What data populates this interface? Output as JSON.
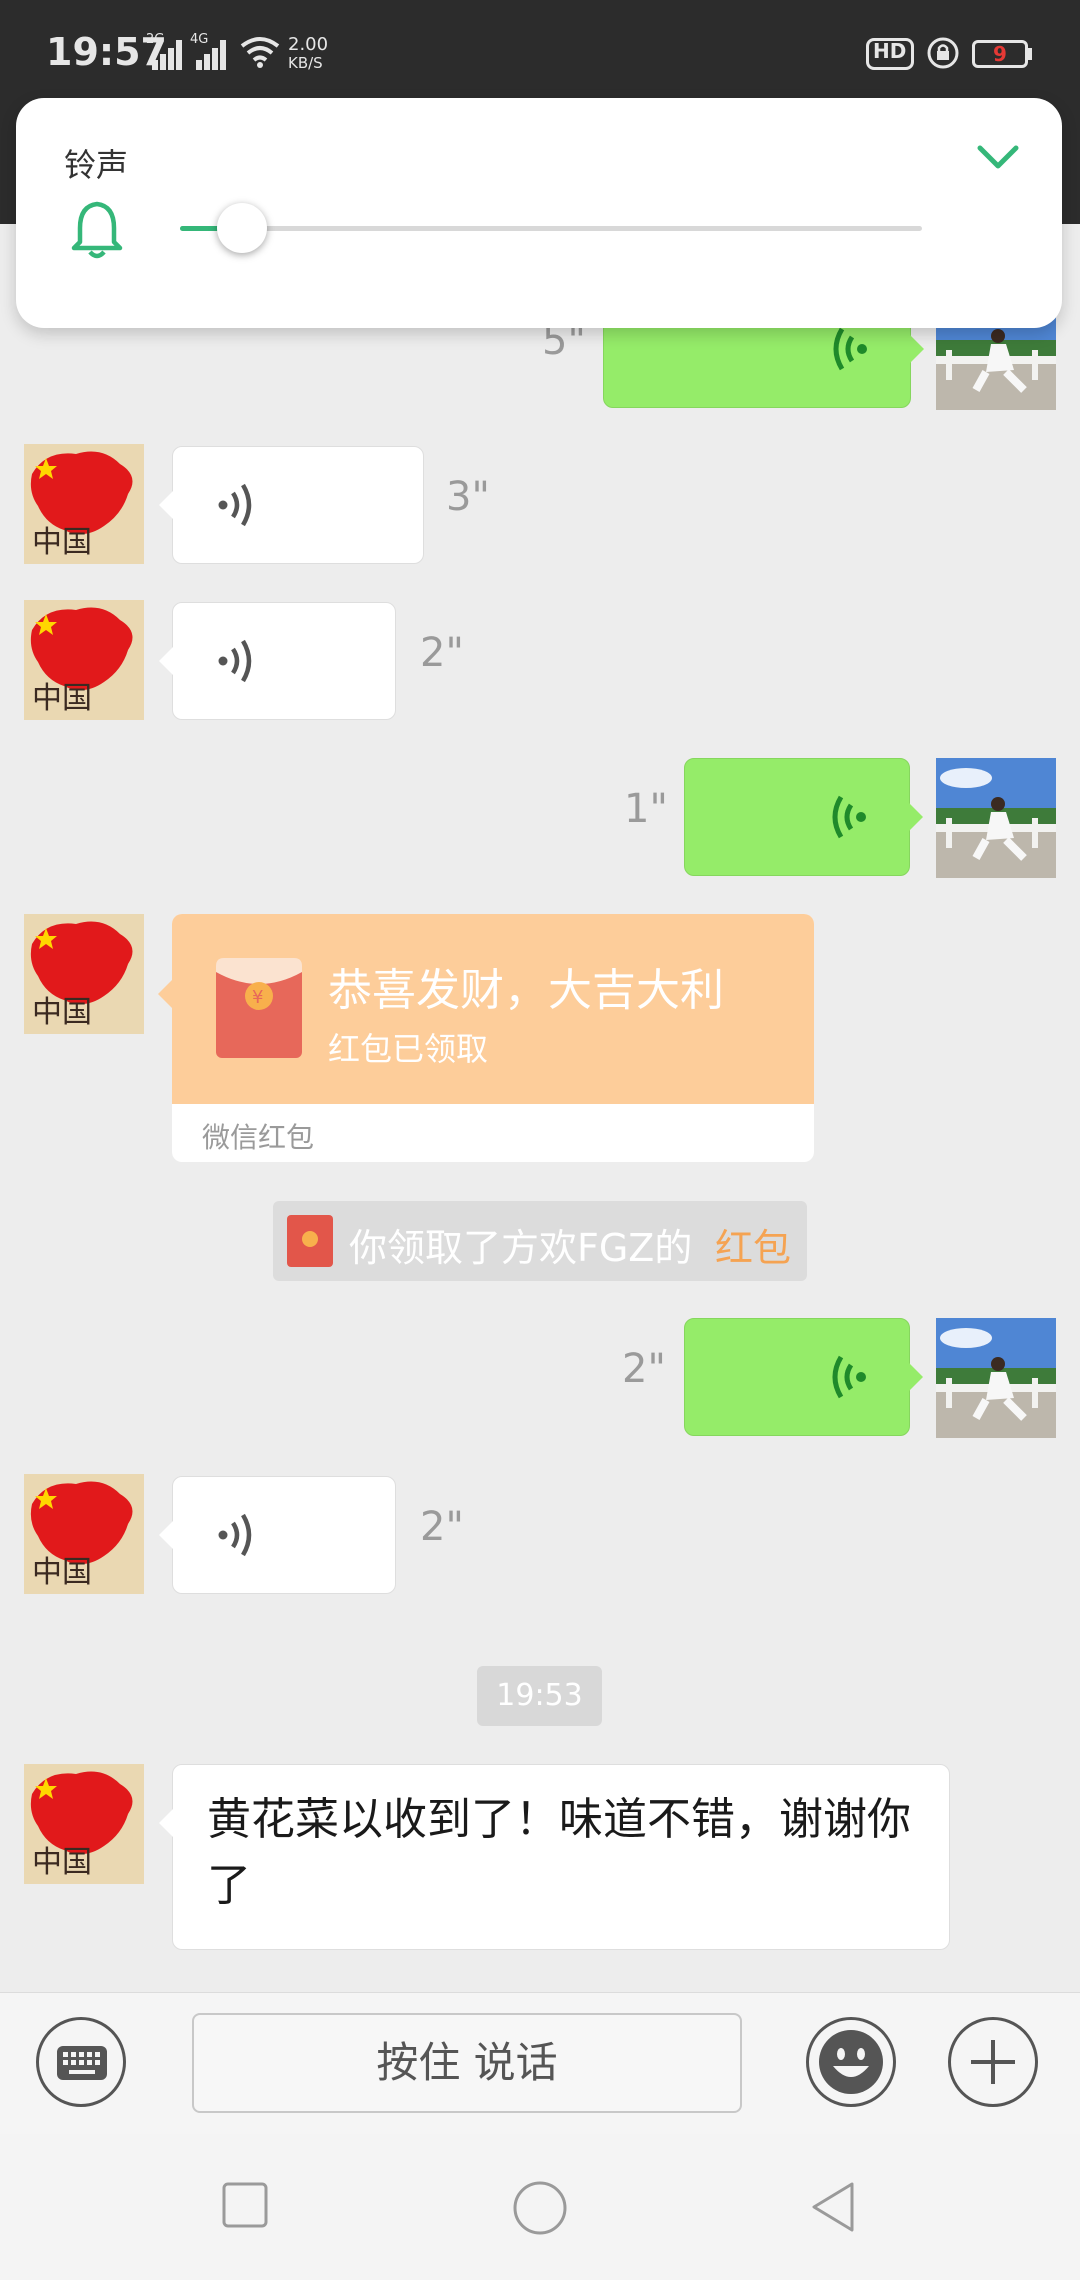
{
  "status_bar": {
    "time": "19:57",
    "net_speed_value": "2.00",
    "net_speed_unit": "KB/S",
    "hd_label": "HD",
    "battery_level": "9"
  },
  "volume_panel": {
    "title": "铃声",
    "level_fraction": 0.05
  },
  "messages": {
    "m1_out_voice_duration": "5\"",
    "m2_in_voice_duration": "3\"",
    "m3_in_voice_duration": "2\"",
    "m4_out_voice_duration": "1\"",
    "red_packet": {
      "title": "恭喜发财，大吉大利",
      "status": "红包已领取",
      "footer": "微信红包",
      "coin_symbol": "¥"
    },
    "system_notice": {
      "text_prefix": "你领取了方欢FGZ的",
      "text_link": "红包"
    },
    "m6_out_voice_duration": "2\"",
    "m7_in_voice_duration": "2\"",
    "timestamp": "19:53",
    "m8_in_text": "黄花菜以收到了！味道不错，谢谢你了"
  },
  "avatar_text": "中国",
  "input_bar": {
    "hold_to_talk_label": "按住 说话"
  },
  "colors": {
    "accent_green": "#35b779",
    "bubble_out": "#95ec69",
    "red_packet": "#fdcd9a",
    "link_orange": "#f5a352"
  }
}
